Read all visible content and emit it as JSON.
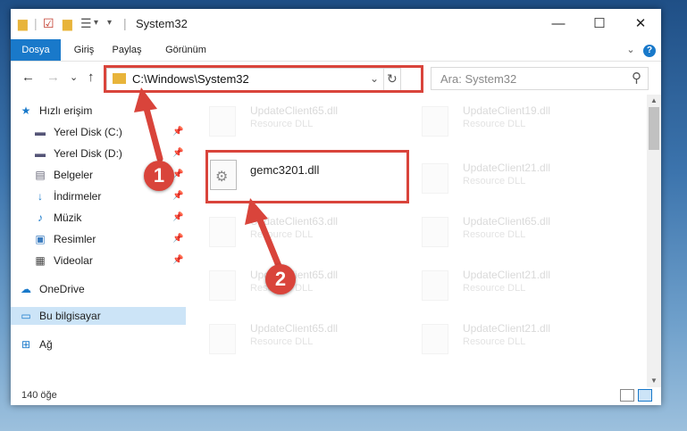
{
  "window": {
    "title": "System32"
  },
  "titlebar": {
    "minimize": "—",
    "maximize": "☐",
    "close": "✕"
  },
  "ribbon": {
    "tabs": [
      "Dosya",
      "Giriş",
      "Paylaş",
      "Görünüm"
    ],
    "collapse": "⌄",
    "help": "?"
  },
  "address": {
    "path": "C:\\Windows\\System32",
    "dropdown": "⌄",
    "refresh": "↻"
  },
  "search": {
    "placeholder": "Ara: System32",
    "icon": "⚲"
  },
  "nav": {
    "back": "←",
    "forward": "→",
    "recent": "⌄",
    "up": "↑"
  },
  "sidebar": {
    "items": [
      {
        "label": "Hızlı erişim",
        "icon": "star-icon"
      },
      {
        "label": "Yerel Disk (C:)",
        "icon": "drive-icon",
        "pinned": true
      },
      {
        "label": "Yerel Disk (D:)",
        "icon": "drive-icon",
        "pinned": true
      },
      {
        "label": "Belgeler",
        "icon": "documents-icon",
        "pinned": true
      },
      {
        "label": "İndirmeler",
        "icon": "download-icon",
        "pinned": true
      },
      {
        "label": "Müzik",
        "icon": "music-icon",
        "pinned": true
      },
      {
        "label": "Resimler",
        "icon": "pictures-icon",
        "pinned": true
      },
      {
        "label": "Videolar",
        "icon": "videos-icon",
        "pinned": true
      },
      {
        "label": "OneDrive",
        "icon": "cloud-icon"
      },
      {
        "label": "Bu bilgisayar",
        "icon": "computer-icon"
      },
      {
        "label": "Ağ",
        "icon": "network-icon"
      }
    ]
  },
  "files": [
    {
      "name": "UpdateClient65.dll",
      "type": "Resource DLL"
    },
    {
      "name": "UpdateClient19.dll",
      "type": "Resource DLL"
    },
    {
      "name": "gemc3201.dll",
      "type": ""
    },
    {
      "name": "UpdateClient21.dll",
      "type": "Resource DLL"
    },
    {
      "name": "UpdateClient63.dll",
      "type": "Resource DLL"
    },
    {
      "name": "UpdateClient65.dll",
      "type": "Resource DLL"
    },
    {
      "name": "UpdateClient65.dll",
      "type": "Resource DLL"
    },
    {
      "name": "UpdateClient21.dll",
      "type": "Resource DLL"
    },
    {
      "name": "UpdateClient65.dll",
      "type": "Resource DLL"
    },
    {
      "name": "UpdateClient21.dll",
      "type": "Resource DLL"
    }
  ],
  "status": {
    "count": "140 öğe"
  },
  "annotations": {
    "step1": "1",
    "step2": "2",
    "color": "#d9443b"
  }
}
